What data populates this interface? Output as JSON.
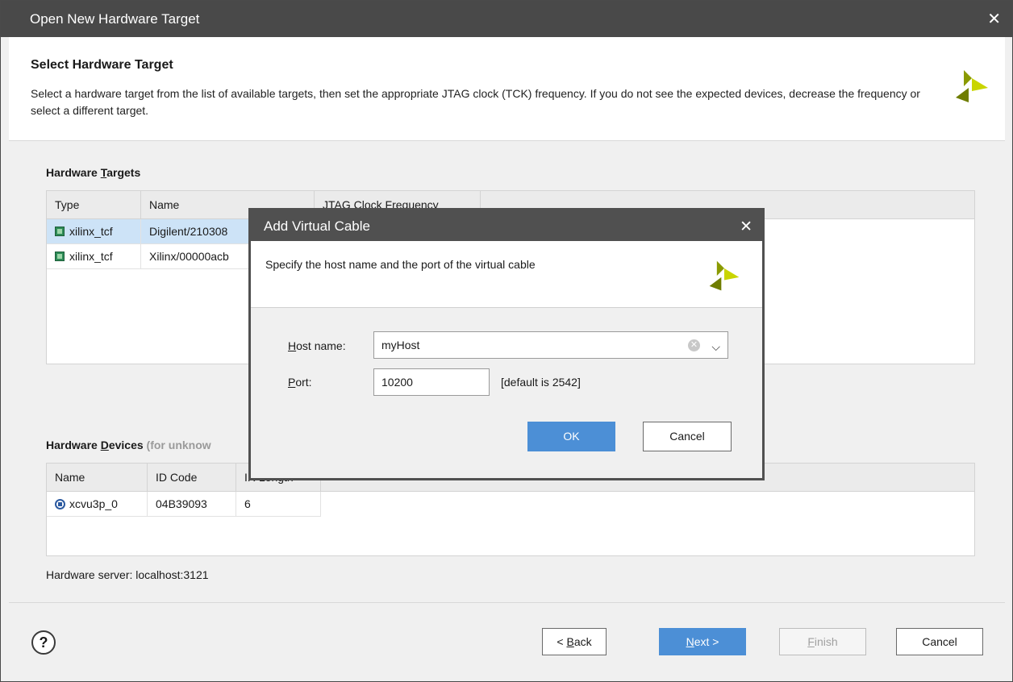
{
  "window": {
    "title": "Open New Hardware Target",
    "close_glyph": "✕"
  },
  "header": {
    "title": "Select Hardware Target",
    "description": "Select a hardware target from the list of available targets, then set the appropriate JTAG clock (TCK) frequency. If you do not see the expected devices, decrease the frequency or select a different target."
  },
  "targets": {
    "label_prefix": "Hardware ",
    "label_mnemonic": "T",
    "label_suffix": "argets",
    "columns": [
      "Type",
      "Name",
      "JTAG Clock Frequency"
    ],
    "rows": [
      {
        "type": "xilinx_tcf",
        "name": "Digilent/210308",
        "freq": "",
        "selected": true
      },
      {
        "type": "xilinx_tcf",
        "name": "Xilinx/00000acb",
        "freq": "",
        "selected": false
      }
    ]
  },
  "devices": {
    "label_prefix": "Hardware ",
    "label_mnemonic": "D",
    "label_suffix": "evices",
    "label_note": "(for unknow",
    "columns": [
      "Name",
      "ID Code",
      "IR Length"
    ],
    "rows": [
      {
        "name": "xcvu3p_0",
        "id_code": "04B39093",
        "ir_length": "6"
      }
    ]
  },
  "status": {
    "server": "Hardware server: localhost:3121"
  },
  "footer": {
    "help": "?",
    "back_prefix": "< ",
    "back_mnemonic": "B",
    "back_suffix": "ack",
    "next_mnemonic": "N",
    "next_suffix": "ext >",
    "finish_mnemonic": "F",
    "finish_suffix": "inish",
    "cancel": "Cancel"
  },
  "dialog": {
    "title": "Add Virtual Cable",
    "close_glyph": "✕",
    "description": "Specify the host name and the port of the virtual cable",
    "host_label_mnemonic": "H",
    "host_label_suffix": "ost name:",
    "host_value": "myHost",
    "port_label_mnemonic": "P",
    "port_label_suffix": "ort:",
    "port_value": "10200",
    "port_hint": "[default is 2542]",
    "ok": "OK",
    "cancel": "Cancel"
  },
  "colors": {
    "accent": "#4c8fd6",
    "titlebar": "#494949",
    "selection": "#cde3f7",
    "logo": "#c9d500"
  }
}
